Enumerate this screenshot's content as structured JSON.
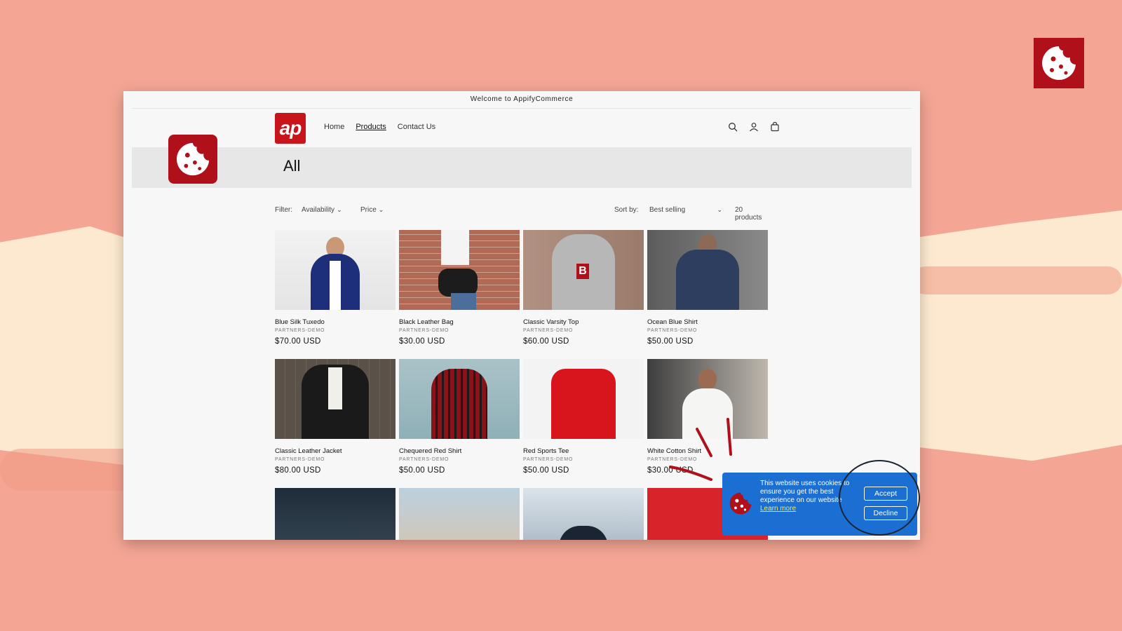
{
  "announcement": "Welcome to AppifyCommerce",
  "logo_text": "ap",
  "nav": [
    {
      "label": "Home",
      "active": false
    },
    {
      "label": "Products",
      "active": true
    },
    {
      "label": "Contact Us",
      "active": false
    }
  ],
  "header_icons": [
    "search-icon",
    "account-icon",
    "cart-icon"
  ],
  "page_title": "All",
  "filter": {
    "label": "Filter:",
    "availability": "Availability",
    "price": "Price",
    "sort_label": "Sort by:",
    "sort_value": "Best selling",
    "count": "20 products"
  },
  "products": [
    {
      "name": "Blue Silk Tuxedo",
      "vendor": "PARTNERS-DEMO",
      "price": "$70.00 USD"
    },
    {
      "name": "Black Leather Bag",
      "vendor": "PARTNERS-DEMO",
      "price": "$30.00 USD"
    },
    {
      "name": "Classic Varsity Top",
      "vendor": "PARTNERS-DEMO",
      "price": "$60.00 USD"
    },
    {
      "name": "Ocean Blue Shirt",
      "vendor": "PARTNERS-DEMO",
      "price": "$50.00 USD"
    },
    {
      "name": "Classic Leather Jacket",
      "vendor": "PARTNERS-DEMO",
      "price": "$80.00 USD"
    },
    {
      "name": "Chequered Red Shirt",
      "vendor": "PARTNERS-DEMO",
      "price": "$50.00 USD"
    },
    {
      "name": "Red Sports Tee",
      "vendor": "PARTNERS-DEMO",
      "price": "$50.00 USD"
    },
    {
      "name": "White Cotton Shirt",
      "vendor": "PARTNERS-DEMO",
      "price": "$30.00 USD"
    }
  ],
  "consent": {
    "message": "This website uses cookies to ensure you get the best experience on our website",
    "learn_more": "Learn more",
    "accept": "Accept",
    "decline": "Decline"
  },
  "colors": {
    "brand": "#c8141b",
    "consent_bg": "#1b6fd3",
    "learn_more": "#ffe34a",
    "background": "#f4a593"
  }
}
